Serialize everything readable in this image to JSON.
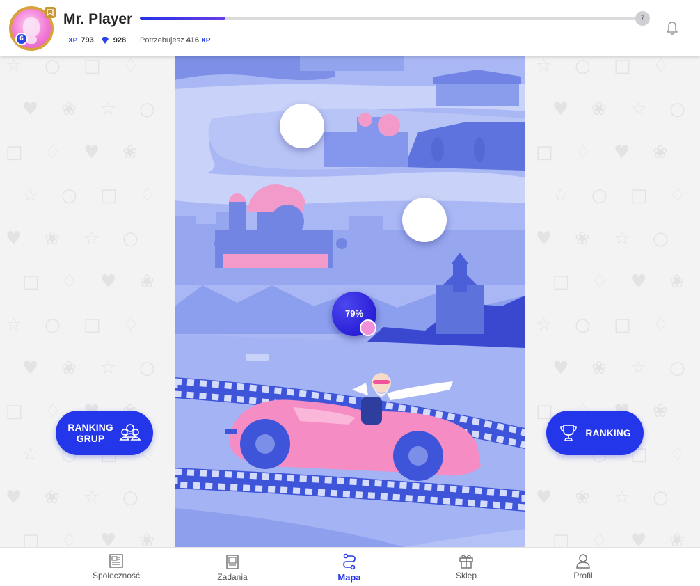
{
  "header": {
    "player_name": "Mr. Player",
    "level": "6",
    "next_level": "7",
    "xp_label": "XP",
    "xp_value": "793",
    "gems_value": "928",
    "need_prefix": "Potrzebujesz",
    "need_value": "416",
    "need_suffix": "XP",
    "level_progress": 0.17
  },
  "map": {
    "current_progress": "79%"
  },
  "buttons": {
    "group_ranking": "RANKING GRUP",
    "ranking": "RANKING"
  },
  "nav": {
    "items": [
      {
        "label": "Społeczność",
        "icon": "newspaper-icon"
      },
      {
        "label": "Zadania",
        "icon": "tasks-icon"
      },
      {
        "label": "Mapa",
        "icon": "route-icon"
      },
      {
        "label": "Sklep",
        "icon": "gift-icon"
      },
      {
        "label": "Profil",
        "icon": "user-icon"
      }
    ],
    "active": "Mapa"
  },
  "colors": {
    "accent": "#2436e9",
    "map_bg": "#a9b7f5",
    "car": "#f58cc3",
    "badge_gold": "#d8a23a"
  }
}
